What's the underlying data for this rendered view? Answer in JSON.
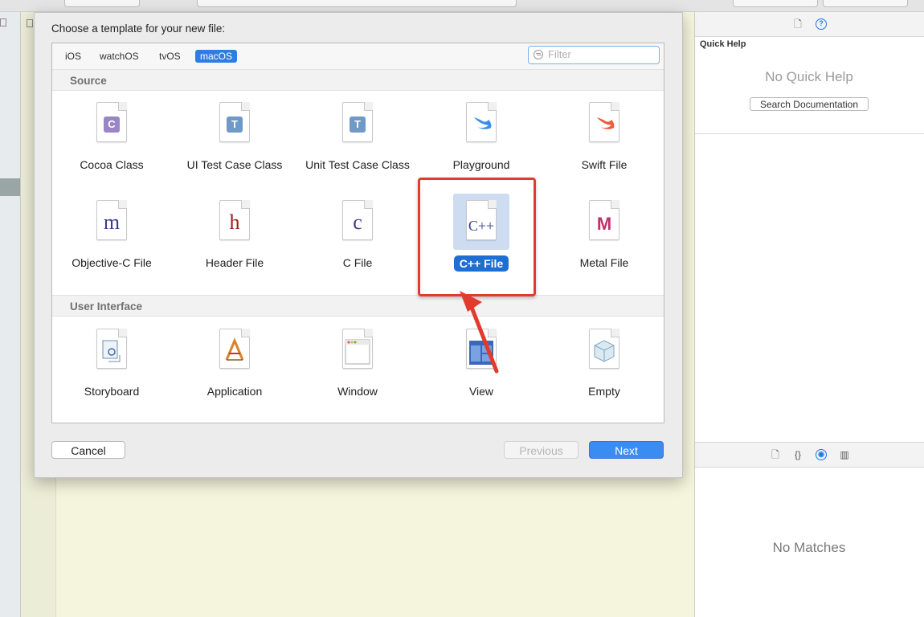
{
  "dialog": {
    "title": "Choose a template for your new file:",
    "platform_tabs": [
      "iOS",
      "watchOS",
      "tvOS",
      "macOS"
    ],
    "selected_platform": "macOS",
    "filter_placeholder": "Filter",
    "sections": {
      "source": {
        "header": "Source",
        "templates": [
          {
            "label": "Cocoa Class",
            "glyph": "C",
            "icon": "cocoa-class-icon"
          },
          {
            "label": "UI Test Case Class",
            "glyph": "T",
            "icon": "ui-test-case-icon"
          },
          {
            "label": "Unit Test Case Class",
            "glyph": "T",
            "icon": "unit-test-case-icon"
          },
          {
            "label": "Playground",
            "icon": "swift-bird-icon"
          },
          {
            "label": "Swift File",
            "icon": "swift-bird-icon"
          },
          {
            "label": "Objective-C File",
            "glyph": "m",
            "icon": "objective-c-file-icon"
          },
          {
            "label": "Header File",
            "glyph": "h",
            "icon": "header-file-icon"
          },
          {
            "label": "C File",
            "glyph": "c",
            "icon": "c-file-icon"
          },
          {
            "label": "C++ File",
            "glyph": "C++",
            "icon": "cpp-file-icon"
          },
          {
            "label": "Metal File",
            "glyph": "M",
            "icon": "metal-file-icon"
          }
        ]
      },
      "user_interface": {
        "header": "User Interface",
        "templates": [
          {
            "label": "Storyboard",
            "icon": "storyboard-icon"
          },
          {
            "label": "Application",
            "icon": "application-icon"
          },
          {
            "label": "Window",
            "icon": "window-icon"
          },
          {
            "label": "View",
            "icon": "view-icon"
          },
          {
            "label": "Empty",
            "icon": "empty-icon"
          }
        ]
      }
    },
    "selected_template": "C++ File",
    "buttons": {
      "cancel": "Cancel",
      "previous": "Previous",
      "next": "Next"
    }
  },
  "inspector": {
    "quick_help_title": "Quick Help",
    "no_quick_help": "No Quick Help",
    "search_documentation": "Search Documentation",
    "no_matches": "No Matches"
  },
  "colors": {
    "accent": "#2f7de1",
    "highlight_box": "#e23b2e",
    "editor_background": "#f4f5dc"
  }
}
